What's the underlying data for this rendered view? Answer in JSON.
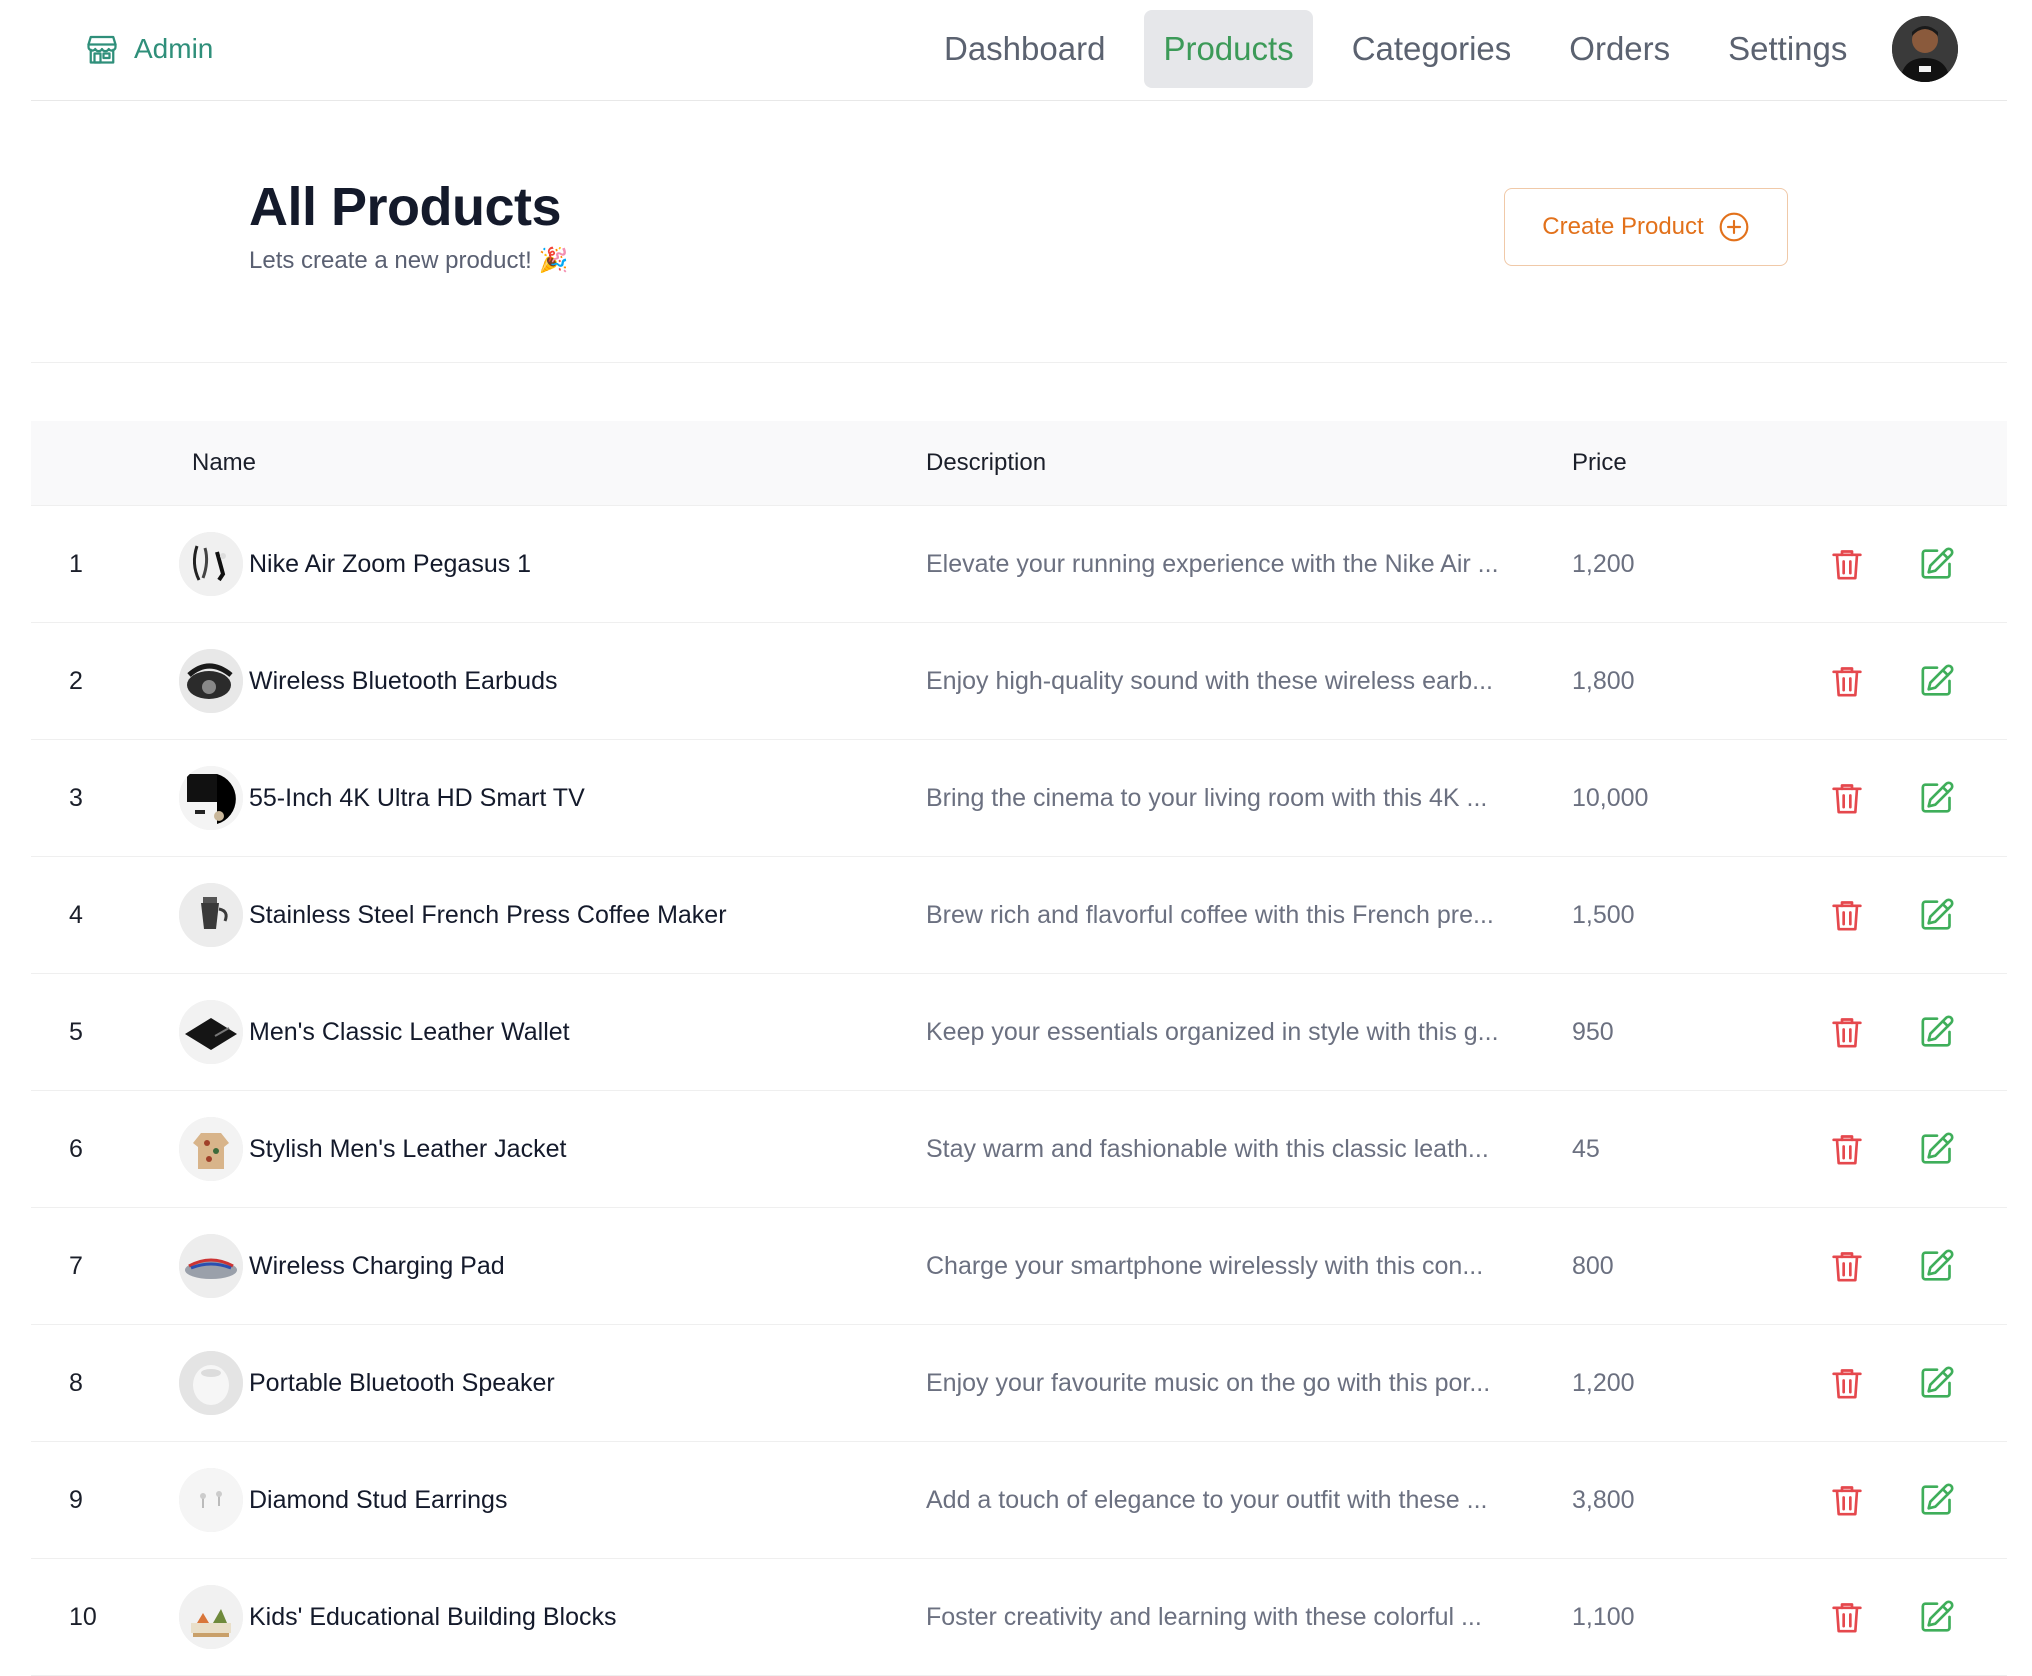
{
  "brand": {
    "label": "Admin",
    "icon": "store-icon"
  },
  "nav": {
    "items": [
      {
        "label": "Dashboard",
        "active": false
      },
      {
        "label": "Products",
        "active": true
      },
      {
        "label": "Categories",
        "active": false
      },
      {
        "label": "Orders",
        "active": false
      },
      {
        "label": "Settings",
        "active": false
      }
    ]
  },
  "page": {
    "title": "All Products",
    "subtitle": "Lets create a new product! 🎉",
    "create_label": "Create Product"
  },
  "table": {
    "headers": {
      "index": "",
      "name": "Name",
      "description": "Description",
      "price": "Price"
    },
    "rows": [
      {
        "index": "1",
        "name": "Nike Air Zoom Pegasus 1",
        "description": "Elevate your running experience with the Nike Air ...",
        "price": "1,200"
      },
      {
        "index": "2",
        "name": "Wireless Bluetooth Earbuds",
        "description": "Enjoy high-quality sound with these wireless earb...",
        "price": "1,800"
      },
      {
        "index": "3",
        "name": "55-Inch 4K Ultra HD Smart TV",
        "description": "Bring the cinema to your living room with this 4K ...",
        "price": "10,000"
      },
      {
        "index": "4",
        "name": "Stainless Steel French Press Coffee Maker",
        "description": "Brew rich and flavorful coffee with this French pre...",
        "price": "1,500"
      },
      {
        "index": "5",
        "name": "Men's Classic Leather Wallet",
        "description": "Keep your essentials organized in style with this g...",
        "price": "950"
      },
      {
        "index": "6",
        "name": "Stylish Men's Leather Jacket",
        "description": "Stay warm and fashionable with this classic leath...",
        "price": "45"
      },
      {
        "index": "7",
        "name": "Wireless Charging Pad",
        "description": "Charge your smartphone wirelessly with this con...",
        "price": "800"
      },
      {
        "index": "8",
        "name": "Portable Bluetooth Speaker",
        "description": "Enjoy your favourite music on the go with this por...",
        "price": "1,200"
      },
      {
        "index": "9",
        "name": "Diamond Stud Earrings",
        "description": "Add a touch of elegance to your outfit with these ...",
        "price": "3,800"
      },
      {
        "index": "10",
        "name": "Kids' Educational Building Blocks",
        "description": "Foster creativity and learning with these colorful ...",
        "price": "1,100"
      }
    ]
  },
  "colors": {
    "brand": "#2f8f7a",
    "nav_active": "#3c9a58",
    "nav_active_bg": "#e6e7ea",
    "create": "#e2711b",
    "delete": "#e5484d",
    "edit": "#3fae5a"
  }
}
